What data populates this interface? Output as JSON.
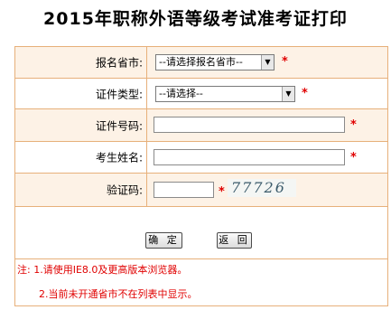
{
  "page": {
    "title": "2015年职称外语等级考试准考证打印"
  },
  "form": {
    "province": {
      "label": "报名省市:",
      "selected": "--请选择报名省市--",
      "required_mark": "*"
    },
    "id_type": {
      "label": "证件类型:",
      "selected": "--请选择--",
      "required_mark": "*"
    },
    "id_number": {
      "label": "证件号码:",
      "value": "",
      "required_mark": "*"
    },
    "name": {
      "label": "考生姓名:",
      "value": "",
      "required_mark": "*"
    },
    "captcha": {
      "label": "验证码:",
      "value": "",
      "required_mark": "*",
      "image_text": "77726"
    }
  },
  "buttons": {
    "confirm": "确 定",
    "back": "返 回"
  },
  "notes": {
    "line1": "注: 1.请使用IE8.0及更高版本浏览器。",
    "line2": "2.当前未开通省市不在列表中显示。"
  },
  "colors": {
    "border": "#e7b07a",
    "shaded_row": "#fdf2e6",
    "required": "#e00000"
  }
}
